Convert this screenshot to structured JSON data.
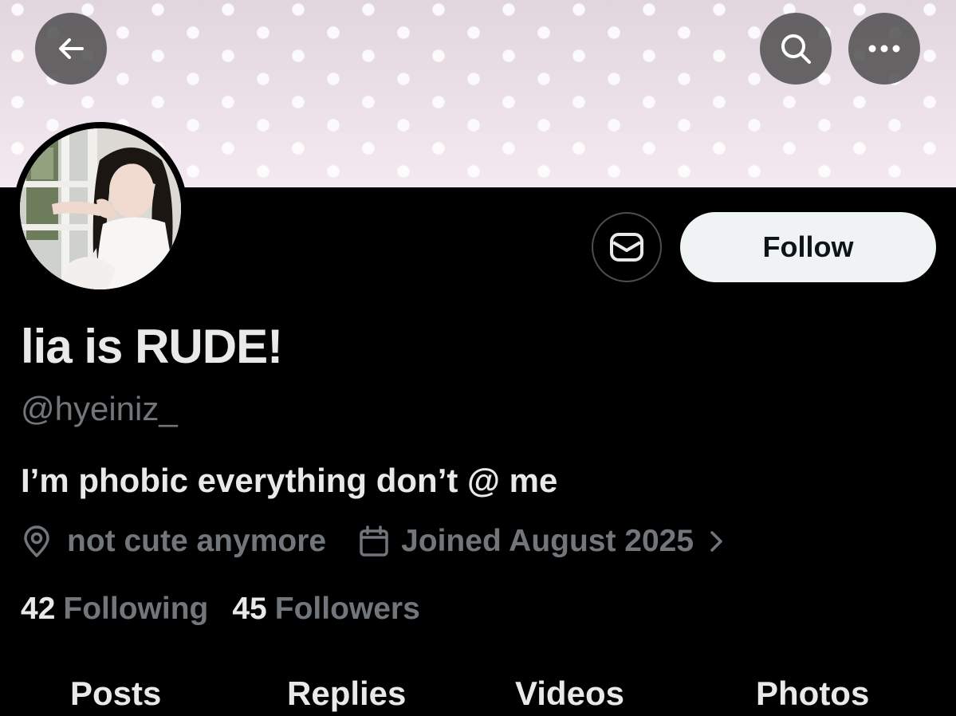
{
  "profile": {
    "display_name": "lia is RUDE!",
    "handle": "@hyeiniz_",
    "bio": "I’m phobic everything don’t @ me",
    "location": "not cute anymore",
    "joined": "Joined August 2025",
    "following_count": "42",
    "following_label": "Following",
    "followers_count": "45",
    "followers_label": "Followers"
  },
  "actions": {
    "follow_label": "Follow"
  },
  "icons": {
    "back": "arrow-left-icon",
    "search": "search-icon",
    "more": "more-horizontal-icon",
    "message": "envelope-icon",
    "location": "location-pin-icon",
    "calendar": "calendar-icon",
    "chevron": "chevron-right-icon"
  },
  "tabs": [
    {
      "label": "Posts"
    },
    {
      "label": "Replies"
    },
    {
      "label": "Videos"
    },
    {
      "label": "Photos"
    }
  ],
  "colors": {
    "background": "#000000",
    "primary_text": "#e7e9ea",
    "secondary_text": "#71767b",
    "follow_button_bg": "#eff3f4"
  }
}
